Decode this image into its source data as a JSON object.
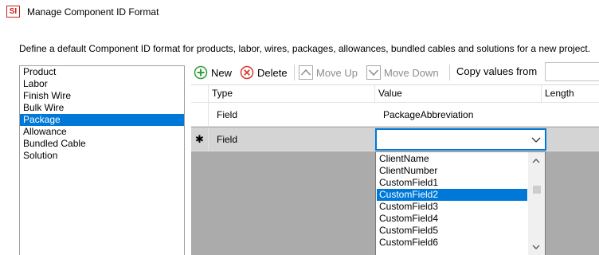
{
  "window": {
    "title": "Manage Component ID Format",
    "icon_text": "SI",
    "icon_color": "#c8201e"
  },
  "description": "Define a default Component ID format for products, labor, wires, packages, allowances, bundled cables and solutions for a new project.",
  "component_types": {
    "items": [
      "Product",
      "Labor",
      "Finish Wire",
      "Bulk Wire",
      "Package",
      "Allowance",
      "Bundled Cable",
      "Solution"
    ],
    "selected": "Package"
  },
  "toolbar": {
    "new_label": "New",
    "delete_label": "Delete",
    "move_up_label": "Move Up",
    "move_down_label": "Move Down",
    "copy_values_label": "Copy values from"
  },
  "grid": {
    "columns": [
      "Type",
      "Value",
      "Length"
    ],
    "rows": [
      {
        "marker": "",
        "type": "Field",
        "value": "PackageAbbreviation"
      },
      {
        "marker": "✱",
        "type": "Field",
        "value": ""
      }
    ]
  },
  "value_dropdown": {
    "options": [
      "ClientName",
      "ClientNumber",
      "CustomField1",
      "CustomField2",
      "CustomField3",
      "CustomField4",
      "CustomField5",
      "CustomField6"
    ],
    "selected": "CustomField2"
  },
  "colors": {
    "selection": "#0078d7",
    "new_icon": "#2e9e3c",
    "delete_icon": "#d83b2f"
  }
}
